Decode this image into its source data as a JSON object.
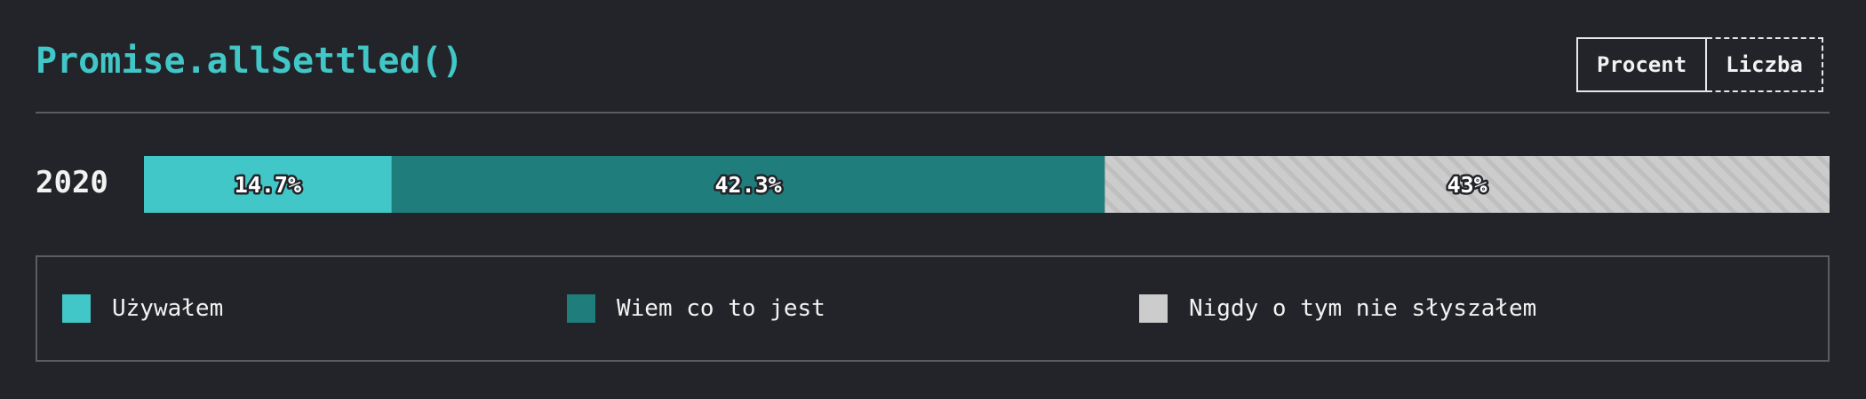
{
  "title": "Promise.allSettled()",
  "toggle": {
    "percent_label": "Procent",
    "count_label": "Liczba",
    "active": "percent"
  },
  "colors": {
    "background": "#232429",
    "title": "#41c7c7",
    "used": "#41c7c7",
    "know": "#1f7d7c",
    "never": "#cccccc"
  },
  "chart_data": {
    "type": "bar",
    "orientation": "horizontal",
    "stacked": true,
    "normalized": true,
    "categories": [
      "2020"
    ],
    "series": [
      {
        "name": "Używałem",
        "values": [
          14.7
        ],
        "label": "14.7%",
        "color": "#41c7c7"
      },
      {
        "name": "Wiem co to jest",
        "values": [
          42.3
        ],
        "label": "42.3%",
        "color": "#1f7d7c"
      },
      {
        "name": "Nigdy o tym nie słyszałem",
        "values": [
          43
        ],
        "label": "43%",
        "color": "#cccccc",
        "pattern": "diagonal-stripes"
      }
    ],
    "xlim": [
      0,
      100
    ],
    "unit": "%",
    "legend_position": "bottom"
  },
  "legend": {
    "items": [
      {
        "label": "Używałem",
        "color": "#41c7c7",
        "icon": "teal-square-swatch"
      },
      {
        "label": "Wiem co to jest",
        "color": "#1f7d7c",
        "icon": "dark-teal-square-swatch"
      },
      {
        "label": "Nigdy o tym nie słyszałem",
        "color": "#cccccc",
        "icon": "gray-square-swatch"
      }
    ]
  }
}
